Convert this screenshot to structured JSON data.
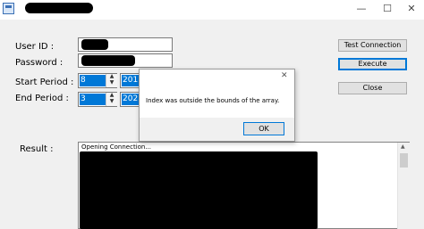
{
  "window": {
    "title_icon": "app-window-icon",
    "minimize_glyph": "—",
    "maximize_glyph": "☐",
    "close_glyph": "✕"
  },
  "form": {
    "user_id_label": "User ID :",
    "password_label": "Password :",
    "start_period_label": "Start Period :",
    "end_period_label": "End Period :",
    "start_month": "8",
    "start_year": "201",
    "end_month": "3",
    "end_year": "202",
    "result_label": "Result :",
    "result_text": "Opening Connection..."
  },
  "buttons": {
    "test_connection": "Test Connection",
    "execute": "Execute",
    "close": "Close"
  },
  "dialog": {
    "message": "Index was outside the bounds of the array.",
    "ok": "OK",
    "close_glyph": "✕"
  },
  "spinner": {
    "up_glyph": "▲",
    "down_glyph": "▼"
  },
  "colors": {
    "selection": "#0078d7",
    "redaction": "#000000"
  }
}
